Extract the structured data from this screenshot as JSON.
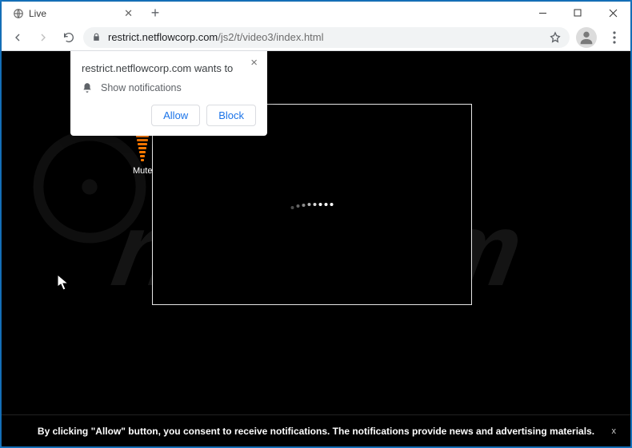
{
  "tab": {
    "title": "Live"
  },
  "url": {
    "domain": "restrict.netflowcorp.com",
    "path": "/js2/t/video3/index.html"
  },
  "permission_prompt": {
    "origin_text": "restrict.netflowcorp.com wants to",
    "permission_label": "Show notifications",
    "allow_label": "Allow",
    "block_label": "Block"
  },
  "volume": {
    "mute_label": "Mute"
  },
  "consent": {
    "text": "By clicking \"Allow\" button, you consent to receive notifications. The notifications provide news and advertising materials.",
    "close_label": "x"
  },
  "watermark": {
    "text": "risk.com"
  }
}
